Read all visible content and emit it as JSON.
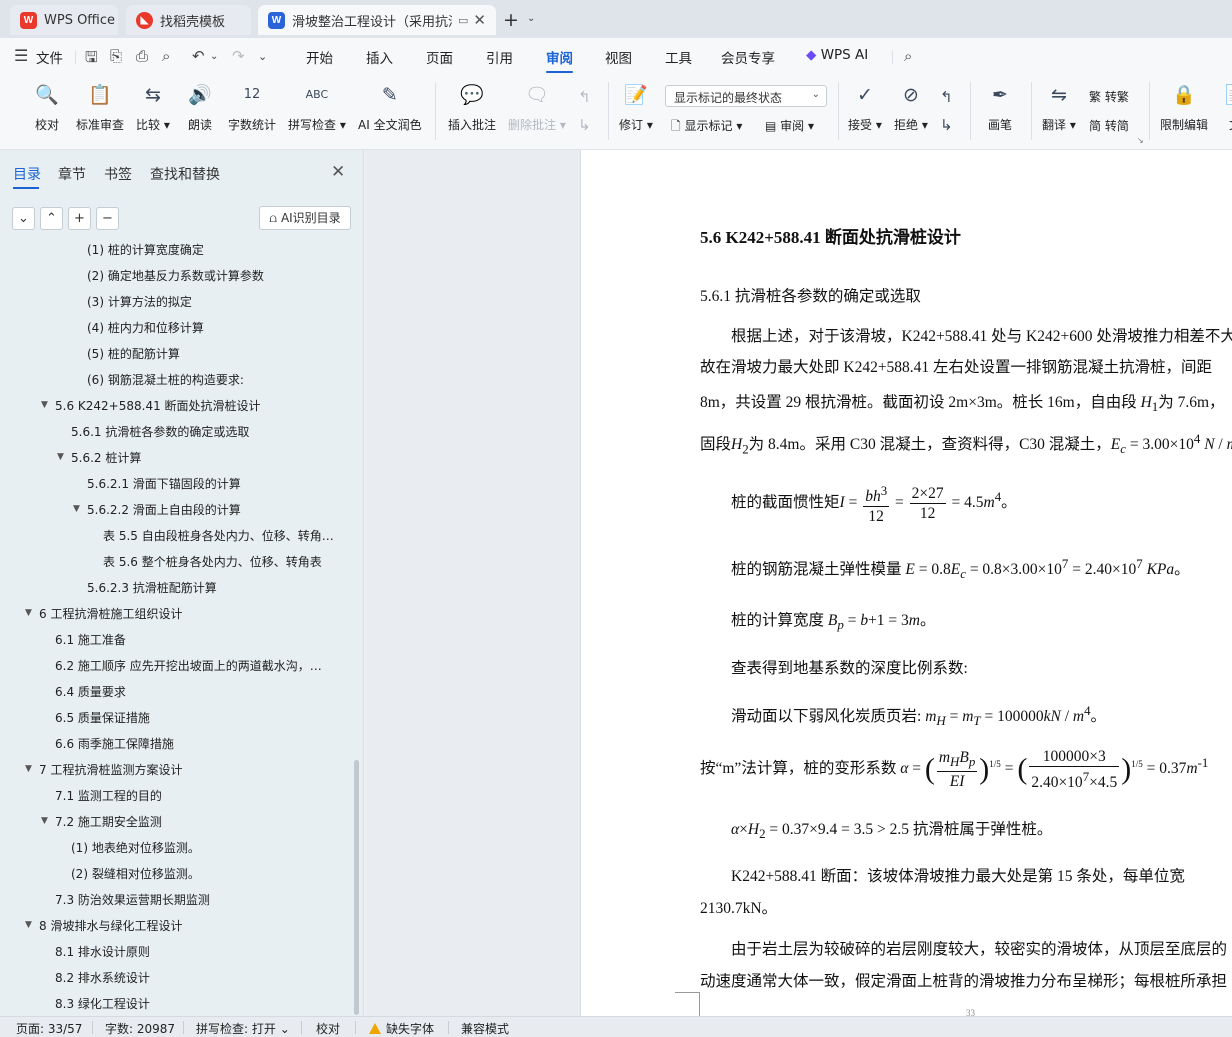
{
  "tabs": [
    {
      "label": "WPS Office",
      "icon": "wps-logo-icon",
      "color": "#e8392c"
    },
    {
      "label": "找稻壳模板",
      "icon": "docer-logo-icon",
      "color": "#e8392c"
    },
    {
      "label": "滑坡整治工程设计（采用抗滑",
      "icon": "word-doc-icon",
      "color": "#2b64d8"
    }
  ],
  "menu": {
    "file": "文件",
    "items": [
      "开始",
      "插入",
      "页面",
      "引用",
      "审阅",
      "视图",
      "工具",
      "会员专享"
    ],
    "active": "审阅",
    "wps_ai": "WPS AI"
  },
  "ribbon": {
    "proofread": "校对",
    "standard_review": "标准审查",
    "compare": "比较",
    "read_aloud": "朗读",
    "word_count": "字数统计",
    "spell_check": "拼写检查",
    "ai_polish": "AI 全文润色",
    "insert_comment": "插入批注",
    "delete_comment": "删除批注",
    "revise": "修订",
    "markup_mode": "显示标记的最终状态",
    "show_markup": "显示标记",
    "review_pane": "审阅",
    "accept": "接受",
    "reject": "拒绝",
    "ink": "画笔",
    "translate": "翻译",
    "to_traditional": "转繁",
    "to_simplified": "转简",
    "restrict_edit": "限制编辑",
    "doc_permission": "文"
  },
  "panel": {
    "tabs": [
      "目录",
      "章节",
      "书签",
      "查找和替换"
    ],
    "ai_toc": "AI识别目录",
    "toc": [
      "(1) 桩的计算宽度确定",
      "(2) 确定地基反力系数或计算参数",
      "(3) 计算方法的拟定",
      "(4) 桩内力和位移计算",
      "(5) 桩的配筋计算",
      "(6) 钢筋混凝土桩的构造要求:",
      "5.6 K242+588.41 断面处抗滑桩设计",
      "5.6.1 抗滑桩各参数的确定或选取",
      "5.6.2 桩计算",
      "5.6.2.1 滑面下锚固段的计算",
      "5.6.2.2 滑面上自由段的计算",
      "表 5.5  自由段桩身各处内力、位移、转角…",
      "表 5.6  整个桩身各处内力、位移、转角表",
      "5.6.2.3 抗滑桩配筋计算",
      "6    工程抗滑桩施工组织设计",
      "6.1 施工准备",
      "6.2 施工顺序   应先开挖出坡面上的两道截水沟，…",
      "6.4 质量要求",
      "6.5 质量保证措施",
      "6.6 雨季施工保障措施",
      "7    工程抗滑桩监测方案设计",
      "7.1  监测工程的目的",
      "7.2 施工期安全监测",
      "(1) 地表绝对位移监测。",
      "(2) 裂缝相对位移监测。",
      "7.3 防治效果运营期长期监测",
      "8    滑坡排水与绿化工程设计",
      "8.1 排水设计原则",
      "8.2 排水系统设计",
      "8.3 绿化工程设计"
    ]
  },
  "doc": {
    "heading": "5.6 K242+588.41 断面处抗滑桩设计",
    "sub": "5.6.1  抗滑桩各参数的确定或选取",
    "p1": "根据上述，对于该滑坡，K242+588.41 处与 K242+600 处滑坡推力相差不大",
    "p2": "故在滑坡力最大处即 K242+588.41 左右处设置一排钢筋混凝土抗滑桩，间距",
    "p3": "8m，共设置 29 根抗滑桩。截面初设 2m×3m。桩长 16m，自由段",
    "p3b": "为 7.6m，",
    "p4": "固段",
    "p4b": "为 8.4m。采用 C30 混凝土，查资料得，C30 混凝土，",
    "inertia_label": "桩的截面惯性矩",
    "modulus_label": "桩的钢筋混凝土弹性模量",
    "width_label": "桩的计算宽度",
    "lookup": "查表得到地基系数的深度比例系数:",
    "rock": "滑动面以下弱风化炭质页岩:",
    "m_method": "按“m”法计算，桩的变形系数",
    "elastic": "抗滑桩属于弹性桩。",
    "p5": "K242+588.41 断面：该坡体滑坡推力最大处是第 15 条处，每单位宽",
    "p6": "2130.7kN。",
    "p7": "由于岩土层为较破碎的岩层刚度较大，较密实的滑坡体，从顶层至底层的",
    "p8": "动速度通常大体一致，假定滑面上桩背的滑坡推力分布呈梯形；每根桩所承担",
    "page_footer": "33"
  },
  "status": {
    "page": "页面: 33/57",
    "words": "字数: 20987",
    "spell": "拼写检查: 打开",
    "proof": "校对",
    "missing_font": "缺失字体",
    "compat": "兼容模式"
  }
}
